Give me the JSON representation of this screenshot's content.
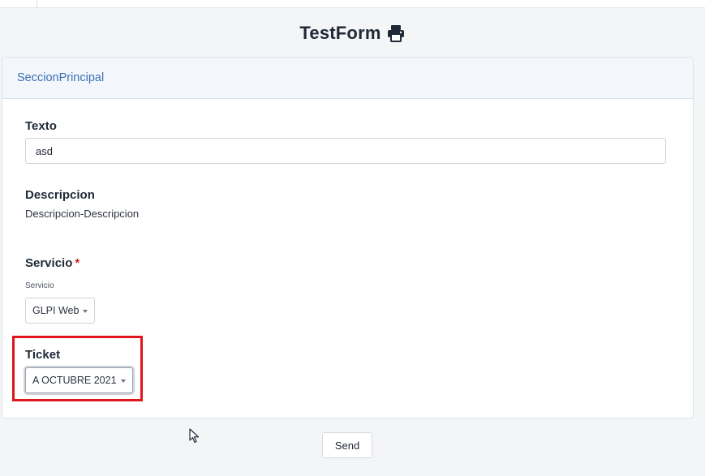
{
  "form": {
    "title": "TestForm",
    "print_icon": "printer-icon"
  },
  "section": {
    "title": "SeccionPrincipal"
  },
  "fields": {
    "texto": {
      "label": "Texto",
      "value": "asd"
    },
    "descripcion": {
      "label": "Descripcion",
      "text": "Descripcion-Descripcion"
    },
    "servicio": {
      "label": "Servicio",
      "required_mark": "*",
      "sublabel": "Servicio",
      "selected": "GLPI Web"
    },
    "ticket": {
      "label": "Ticket",
      "selected": "A OCTUBRE 2021"
    }
  },
  "actions": {
    "send_label": "Send"
  },
  "colors": {
    "accent": "#3a70b5",
    "required": "#d11f1f",
    "highlight": "#e0161d"
  }
}
